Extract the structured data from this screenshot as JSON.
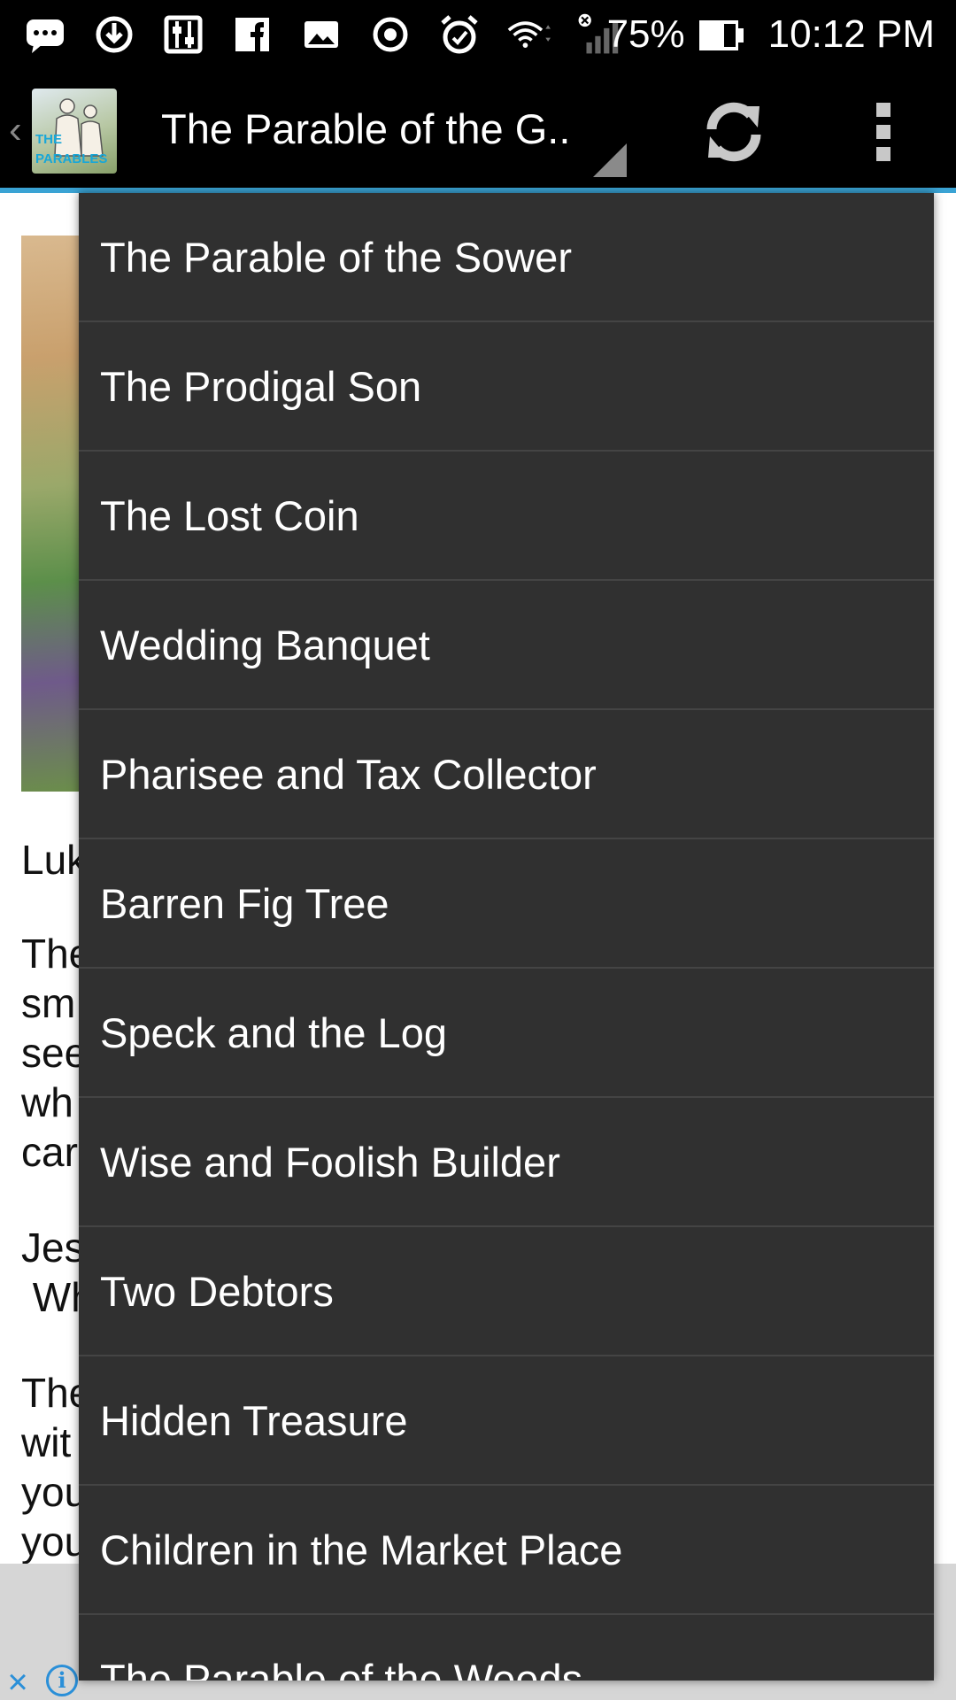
{
  "status_bar": {
    "battery": "75%",
    "time": "10:12 PM",
    "icons": [
      "chat-icon",
      "download-icon",
      "equalizer-icon",
      "facebook-icon",
      "photo-icon",
      "record-icon",
      "alarm-icon",
      "wifi-icon",
      "signal-icon",
      "battery-icon"
    ]
  },
  "action_bar": {
    "title": "The Parable of the G..",
    "logo_line1": "THE",
    "logo_line2": "PARABLES"
  },
  "page": {
    "lines": [
      "Luk",
      "The",
      "sm",
      "see",
      "wh",
      "car",
      "Jes",
      " Wh",
      "The",
      "wit",
      "you",
      "you"
    ]
  },
  "dropdown": {
    "items": [
      "The Parable of the Sower",
      "The Prodigal Son",
      "The Lost Coin",
      "Wedding Banquet",
      "Pharisee and Tax Collector",
      "Barren Fig Tree",
      "Speck and the Log",
      "Wise and Foolish Builder",
      "Two Debtors",
      "Hidden Treasure",
      "Children in the Market Place",
      "The Parable of the Weeds"
    ]
  },
  "colors": {
    "action_bar_bg": "#000000",
    "accent_line": "#3aa3d4",
    "dropdown_bg": "#303030",
    "divider": "#444444"
  }
}
